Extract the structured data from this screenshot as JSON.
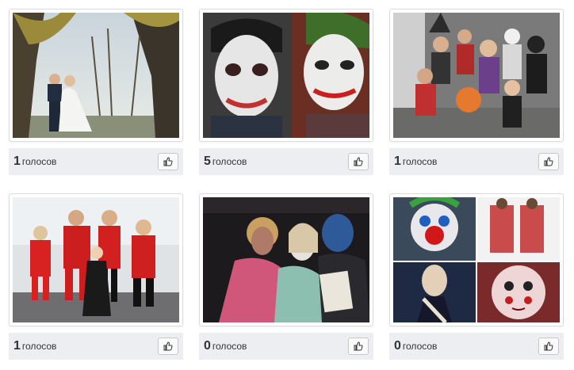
{
  "vote_unit": "голосов",
  "items": [
    {
      "photo": "wedding-couple-photo",
      "votes": "1"
    },
    {
      "photo": "joker-makeup-photo",
      "votes": "5"
    },
    {
      "photo": "kids-halloween-costumes-photo",
      "votes": "1"
    },
    {
      "photo": "incredibles-family-costume-photo",
      "votes": "1"
    },
    {
      "photo": "zombie-party-photo",
      "votes": "0"
    },
    {
      "photo": "halloween-makeup-collage-photo",
      "votes": "0"
    }
  ],
  "like_icon": "thumbs-up-icon"
}
